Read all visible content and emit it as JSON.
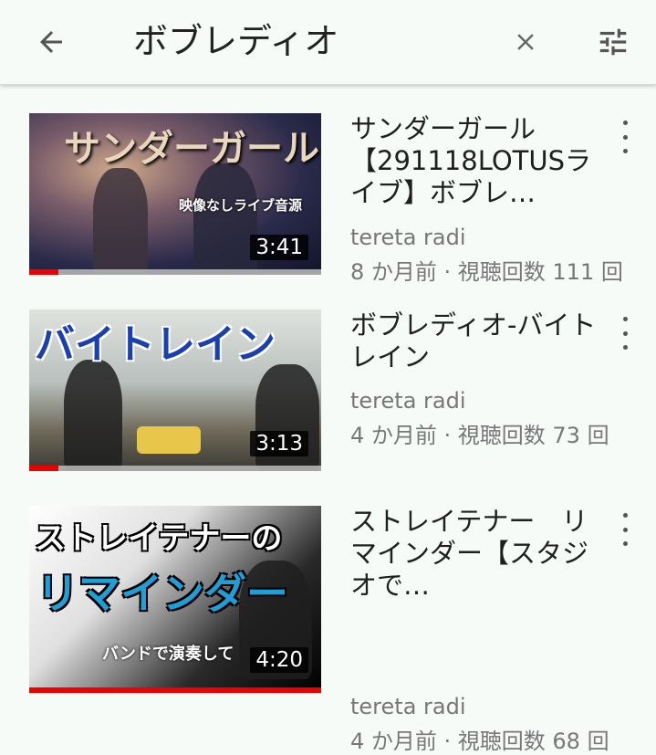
{
  "search": {
    "query": "ボブレディオ"
  },
  "icons": {
    "back": "arrow-back-icon",
    "clear": "close-icon",
    "filter": "tune-icon",
    "more": "more-vert-icon"
  },
  "videos": [
    {
      "thumb_title": "サンダーガール",
      "thumb_subtitle": "映像なしライブ音源",
      "duration": "3:41",
      "title": "サンダーガール【291118LOTUSライブ】ボブレ…",
      "channel": "tereta radi",
      "meta": "8 か月前 · 視聴回数 111 回",
      "progress": 0.1
    },
    {
      "thumb_title": "バイトレイン",
      "thumb_subtitle": "",
      "duration": "3:13",
      "title": "ボブレディオ-バイトレイン",
      "channel": "tereta radi",
      "meta": "4 か月前 · 視聴回数 73 回",
      "progress": 0.1
    },
    {
      "thumb_title": "ストレイテナーの",
      "thumb_title2": "リマインダー",
      "thumb_subtitle": "バンドで演奏して",
      "duration": "4:20",
      "title": "ストレイテナー　リマインダー【スタジオで…",
      "channel": "tereta radi",
      "meta": "4 か月前 · 視聴回数 68 回",
      "progress": 1.0
    }
  ],
  "colors": {
    "accent": "#e00000",
    "background": "#f7fbf8",
    "text_secondary": "#777777"
  }
}
